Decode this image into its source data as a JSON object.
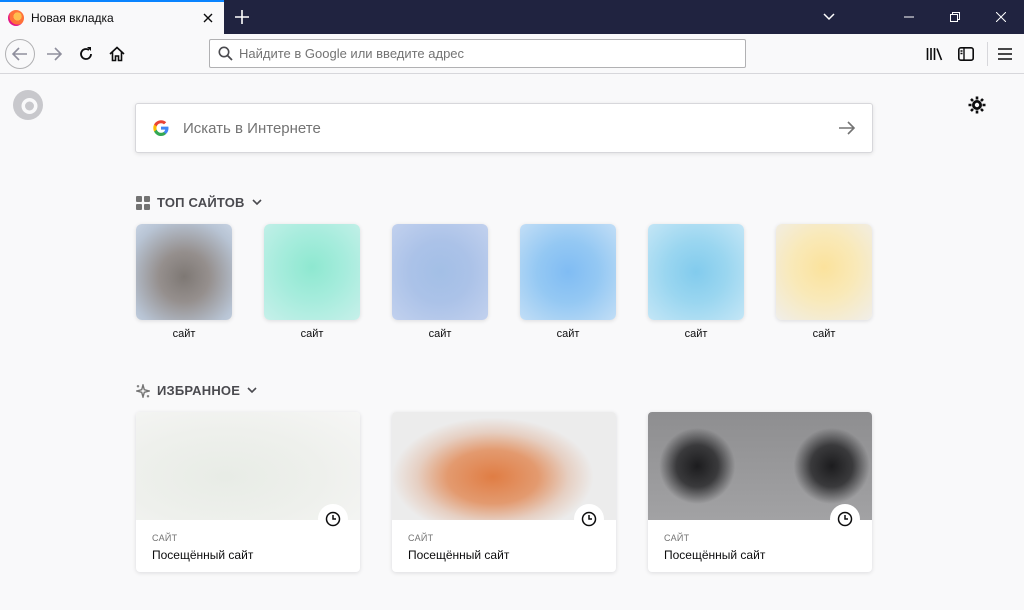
{
  "tab": {
    "title": "Новая вкладка",
    "close_icon": "close-icon"
  },
  "urlbar": {
    "placeholder": "Найдите в Google или введите адрес"
  },
  "search": {
    "placeholder": "Искать в Интернете",
    "engine_icon": "google-icon"
  },
  "topsites": {
    "heading": "ТОП САЙТОВ",
    "items": [
      {
        "label": "сайт",
        "color": "#8e8a8b"
      },
      {
        "label": "сайт",
        "color": "#9fe8d5"
      },
      {
        "label": "сайт",
        "color": "#a5bde8"
      },
      {
        "label": "сайт",
        "color": "#8fc3f3"
      },
      {
        "label": "сайт",
        "color": "#8fd3ef"
      },
      {
        "label": "сайт",
        "color": "#fbe7ad"
      }
    ]
  },
  "highlights": {
    "heading": "ИЗБРАННОЕ",
    "items": [
      {
        "host": "САЙТ",
        "title": "Посещённый сайт"
      },
      {
        "host": "САЙТ",
        "title": "Посещённый сайт"
      },
      {
        "host": "САЙТ",
        "title": "Посещённый сайт"
      }
    ]
  },
  "colors": {
    "titlebar": "#202340",
    "accent": "#0a84ff",
    "background": "#f9f9fa"
  }
}
